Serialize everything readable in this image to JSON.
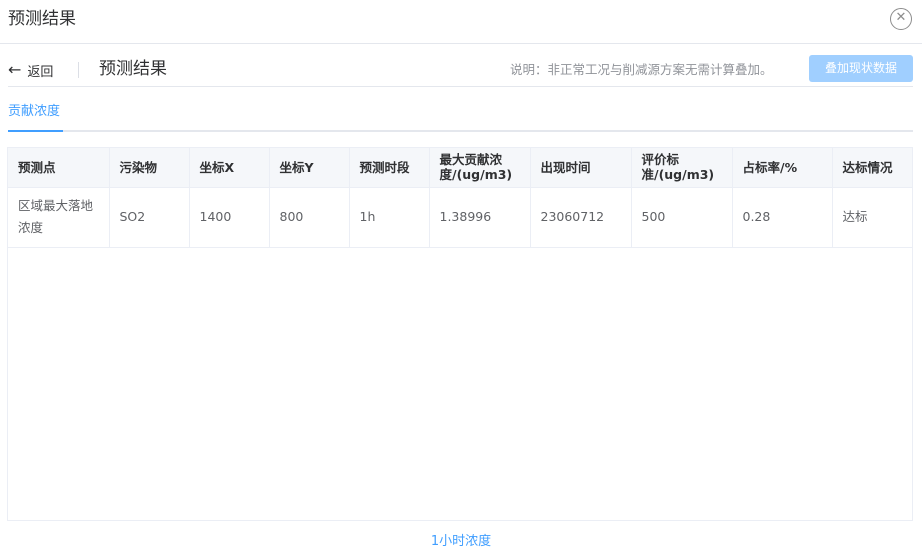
{
  "dialog": {
    "title": "预测结果",
    "close_icon": "close-circle-icon"
  },
  "subbar": {
    "back_icon": "arrow-left-icon",
    "back_label": "返回",
    "title": "预测结果",
    "note": "说明：非正常工况与削减源方案无需计算叠加。",
    "overlay_button": "叠加现状数据"
  },
  "tabs": [
    {
      "label": "贡献浓度",
      "active": true
    }
  ],
  "table": {
    "headers": [
      "预测点",
      "污染物",
      "坐标X",
      "坐标Y",
      "预测时段",
      "最大贡献浓度/(ug/m3)",
      "出现时间",
      "评价标准/(ug/m3)",
      "占标率/%",
      "达标情况"
    ],
    "rows": [
      [
        "区域最大落地浓度",
        "SO2",
        "1400",
        "800",
        "1h",
        "1.38996",
        "23060712",
        "500",
        "0.28",
        "达标"
      ]
    ]
  },
  "footer": {
    "link": "1小时浓度"
  },
  "colors": {
    "accent": "#409eff",
    "button_disabled": "#a0cfff",
    "header_bg": "#f5f7fa"
  }
}
